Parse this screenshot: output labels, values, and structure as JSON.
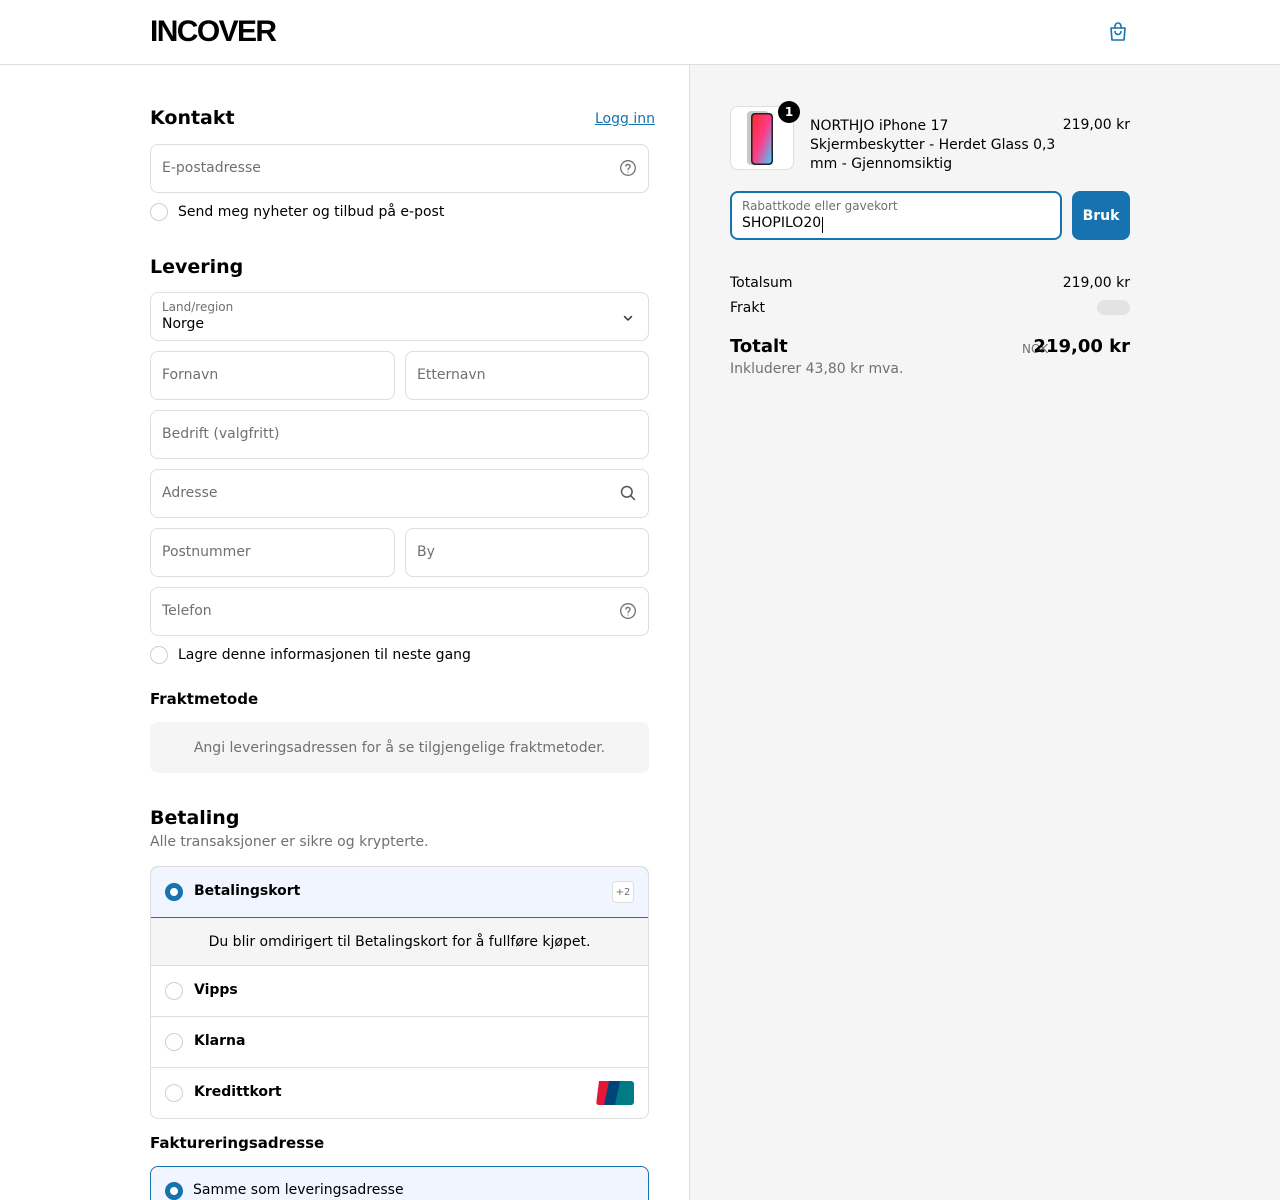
{
  "header": {
    "logo": "INCOVER"
  },
  "contact": {
    "title": "Kontakt",
    "login_link": "Logg inn",
    "email_placeholder": "E-postadresse",
    "newsletter_label": "Send meg nyheter og tilbud på e-post"
  },
  "delivery": {
    "title": "Levering",
    "country_label": "Land/region",
    "country_value": "Norge",
    "first_name_placeholder": "Fornavn",
    "last_name_placeholder": "Etternavn",
    "company_placeholder": "Bedrift (valgfritt)",
    "address_placeholder": "Adresse",
    "postal_placeholder": "Postnummer",
    "city_placeholder": "By",
    "phone_placeholder": "Telefon",
    "save_info_label": "Lagre denne informasjonen til neste gang"
  },
  "shipping": {
    "title": "Fraktmetode",
    "info": "Angi leveringsadressen for å se tilgjengelige fraktmetoder."
  },
  "payment": {
    "title": "Betaling",
    "subtitle": "Alle transaksjoner er sikre og krypterte.",
    "methods": [
      {
        "label": "Betalingskort",
        "selected": true,
        "badge": "+2"
      },
      {
        "label": "Vipps",
        "selected": false
      },
      {
        "label": "Klarna",
        "selected": false
      },
      {
        "label": "Kredittkort",
        "selected": false,
        "icon": "unionpay-icon"
      }
    ],
    "redirect_note": "Du blir omdirigert til Betalingskort for å fullføre kjøpet."
  },
  "billing": {
    "title": "Faktureringsadresse",
    "same_as_shipping": "Samme som leveringsadresse"
  },
  "summary": {
    "product": {
      "name": "NORTHJO iPhone 17 Skjermbeskytter - Herdet Glass 0,3 mm - Gjennomsiktig",
      "price": "219,00 kr",
      "quantity": "1"
    },
    "discount": {
      "label": "Rabattkode eller gavekort",
      "value": "SHOPILO20",
      "apply_label": "Bruk"
    },
    "subtotal_label": "Totalsum",
    "subtotal_value": "219,00 kr",
    "shipping_label": "Frakt",
    "total_label": "Totalt",
    "total_currency": "NOK",
    "total_value": "219,00 kr",
    "tax_note": "Inkluderer 43,80 kr mva."
  },
  "colors": {
    "accent": "#1773b0",
    "border": "#dedede",
    "summary_bg": "#f5f5f5"
  }
}
